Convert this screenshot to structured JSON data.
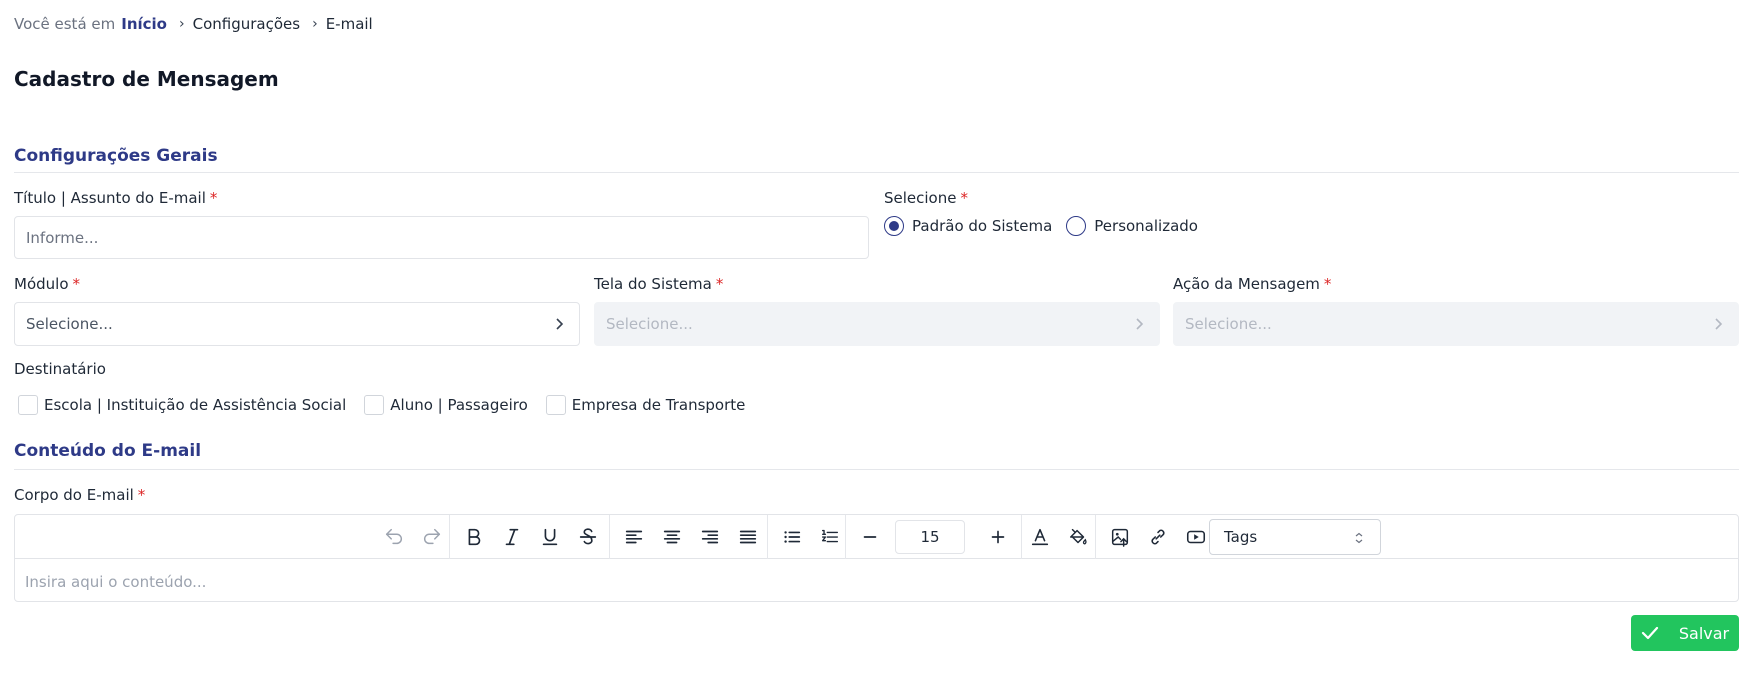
{
  "breadcrumb": {
    "prefix": "Você está em",
    "home": "Início",
    "items": [
      "Configurações",
      "E-mail"
    ]
  },
  "page_title": "Cadastro de Mensagem",
  "sections": {
    "general": "Configurações Gerais",
    "content": "Conteúdo do E-mail"
  },
  "form": {
    "title_label": "Título | Assunto do E-mail",
    "title_placeholder": "Informe...",
    "select_label": "Selecione",
    "radio_options": [
      "Padrão do Sistema",
      "Personalizado"
    ],
    "radio_selected": "Padrão do Sistema",
    "module_label": "Módulo",
    "module_placeholder": "Selecione...",
    "screen_label": "Tela do Sistema",
    "screen_placeholder": "Selecione...",
    "action_label": "Ação da Mensagem",
    "action_placeholder": "Selecione...",
    "recipient_label": "Destinatário",
    "recipients": [
      "Escola | Instituição de Assistência Social",
      "Aluno | Passageiro",
      "Empresa de Transporte"
    ],
    "body_label": "Corpo do E-mail",
    "required_mark": "*"
  },
  "editor": {
    "font_size": "15",
    "tags_label": "Tags",
    "placeholder": "Insira aqui o conteúdo..."
  },
  "actions": {
    "save_label": "Salvar"
  },
  "colors": {
    "accent": "#2e3a87",
    "required": "#dc2626",
    "save": "#22c55e"
  }
}
